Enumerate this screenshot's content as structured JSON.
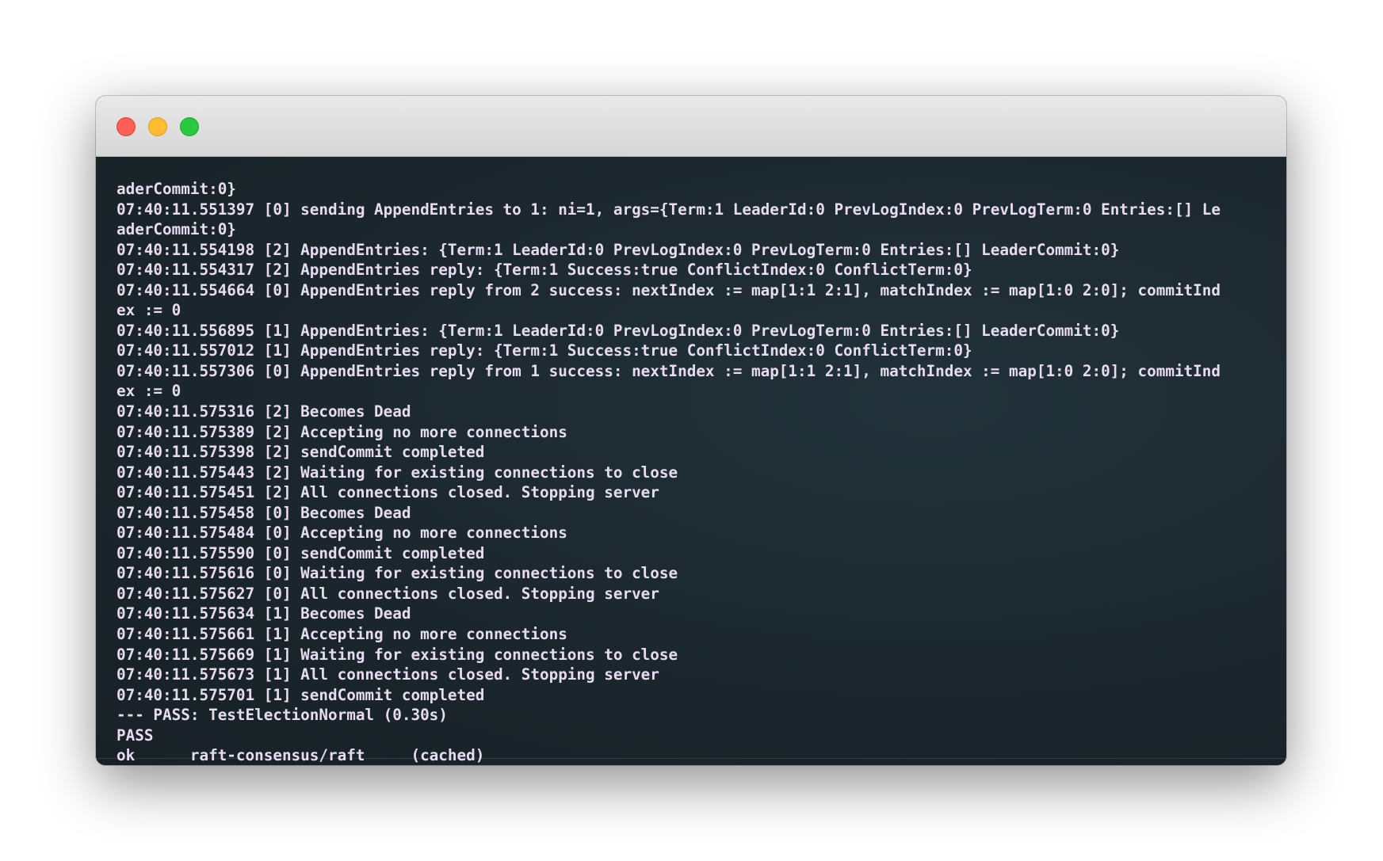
{
  "window": {
    "controls": {
      "close_icon": "close-icon",
      "minimize_icon": "minimize-icon",
      "maximize_icon": "maximize-icon",
      "close_color": "#fe5f57",
      "minimize_color": "#febc2e",
      "maximize_color": "#28c840"
    }
  },
  "terminal": {
    "background_color": "#1c2a30",
    "text_color": "#e6dbf0",
    "lines": [
      "aderCommit:0}",
      "07:40:11.551397 [0] sending AppendEntries to 1: ni=1, args={Term:1 LeaderId:0 PrevLogIndex:0 PrevLogTerm:0 Entries:[] Le",
      "aderCommit:0}",
      "07:40:11.554198 [2] AppendEntries: {Term:1 LeaderId:0 PrevLogIndex:0 PrevLogTerm:0 Entries:[] LeaderCommit:0}",
      "07:40:11.554317 [2] AppendEntries reply: {Term:1 Success:true ConflictIndex:0 ConflictTerm:0}",
      "07:40:11.554664 [0] AppendEntries reply from 2 success: nextIndex := map[1:1 2:1], matchIndex := map[1:0 2:0]; commitInd",
      "ex := 0",
      "07:40:11.556895 [1] AppendEntries: {Term:1 LeaderId:0 PrevLogIndex:0 PrevLogTerm:0 Entries:[] LeaderCommit:0}",
      "07:40:11.557012 [1] AppendEntries reply: {Term:1 Success:true ConflictIndex:0 ConflictTerm:0}",
      "07:40:11.557306 [0] AppendEntries reply from 1 success: nextIndex := map[1:1 2:1], matchIndex := map[1:0 2:0]; commitInd",
      "ex := 0",
      "07:40:11.575316 [2] Becomes Dead",
      "07:40:11.575389 [2] Accepting no more connections",
      "07:40:11.575398 [2] sendCommit completed",
      "07:40:11.575443 [2] Waiting for existing connections to close",
      "07:40:11.575451 [2] All connections closed. Stopping server",
      "07:40:11.575458 [0] Becomes Dead",
      "07:40:11.575484 [0] Accepting no more connections",
      "07:40:11.575590 [0] sendCommit completed",
      "07:40:11.575616 [0] Waiting for existing connections to close",
      "07:40:11.575627 [0] All connections closed. Stopping server",
      "07:40:11.575634 [1] Becomes Dead",
      "07:40:11.575661 [1] Accepting no more connections",
      "07:40:11.575669 [1] Waiting for existing connections to close",
      "07:40:11.575673 [1] All connections closed. Stopping server",
      "07:40:11.575701 [1] sendCommit completed",
      "--- PASS: TestElectionNormal (0.30s)",
      "PASS",
      "ok      raft-consensus/raft     (cached)"
    ]
  }
}
